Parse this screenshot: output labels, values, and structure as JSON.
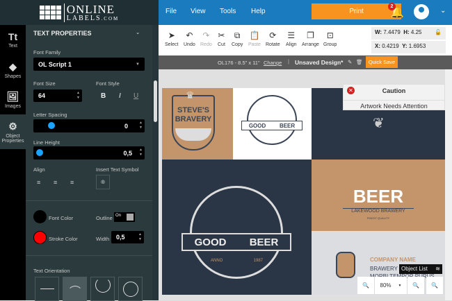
{
  "logo": {
    "line1": "ONLINE",
    "line2": "LABELS",
    "suffix": ".COM"
  },
  "rail": [
    {
      "icon": "text-icon",
      "glyph": "Tt",
      "label": "Text"
    },
    {
      "icon": "shapes-icon",
      "glyph": "◆",
      "label": "Shapes"
    },
    {
      "icon": "images-icon",
      "glyph": "🖼",
      "label": "Images"
    },
    {
      "icon": "gear-icon",
      "glyph": "⚙",
      "label": "Object Properties"
    }
  ],
  "panel": {
    "title": "TEXT PROPERTIES",
    "font_family_label": "Font Family",
    "font_family": "OL Script 1",
    "font_size_label": "Font Size",
    "font_size": "64",
    "font_style_label": "Font Style",
    "bold": "B",
    "italic": "I",
    "underline": "U",
    "letter_spacing_label": "Letter Spacing",
    "letter_spacing": "0",
    "line_height_label": "Line Height",
    "line_height": "0,5",
    "align_label": "Align",
    "insert_symbol_label": "Insert Text Symbol",
    "symbol": "®",
    "font_color_label": "Font Color",
    "font_color": "#000000",
    "outline_label": "Outline",
    "outline_state": "On",
    "stroke_color_label": "Stroke Color",
    "stroke_color": "#ff0000",
    "width_label": "Width",
    "width": "0,5",
    "orientation_label": "Text Orientation"
  },
  "topbar": {
    "menu": [
      "File",
      "View",
      "Tools",
      "Help"
    ],
    "print": "Print",
    "notifications": "2"
  },
  "toolbar": {
    "tools": [
      "Select",
      "Undo",
      "Redo",
      "Cut",
      "Copy",
      "Paste",
      "Rotate",
      "Align",
      "Arrange",
      "Group"
    ],
    "w_label": "W:",
    "w": "7.4479",
    "h_label": "H:",
    "h": "4.25",
    "x_label": "X:",
    "x": "0.4219",
    "y_label": "Y:",
    "y": "1.6953"
  },
  "docbar": {
    "template": "OL176 - 8.5\" x 11\"",
    "change": "Change",
    "design": "Unsaved Design*",
    "quick_save": "Quick Save"
  },
  "canvas": {
    "caution_title": "Caution",
    "caution_msg": "Artwork Needs Attention",
    "steves1": "STEVE'S",
    "steves2": "BRAVERY",
    "good": "GOOD",
    "beer": "BEER",
    "anno": "ANNO",
    "year": "1987",
    "beer_big": "BEER",
    "lakewood": "LAKEWOOD BRAWERY",
    "finest": "FINEST QUALITY",
    "company": "COMPANY NAME",
    "brawery": "BRAWERY S",
    "morbi": "MORBI TEMPOR PURUS",
    "object_list": "Object List",
    "zoom": "80%"
  },
  "colors": {
    "accent": "#1a7bbf",
    "print": "#f7931e",
    "tan": "#c4956a",
    "navy": "#2a3646"
  }
}
